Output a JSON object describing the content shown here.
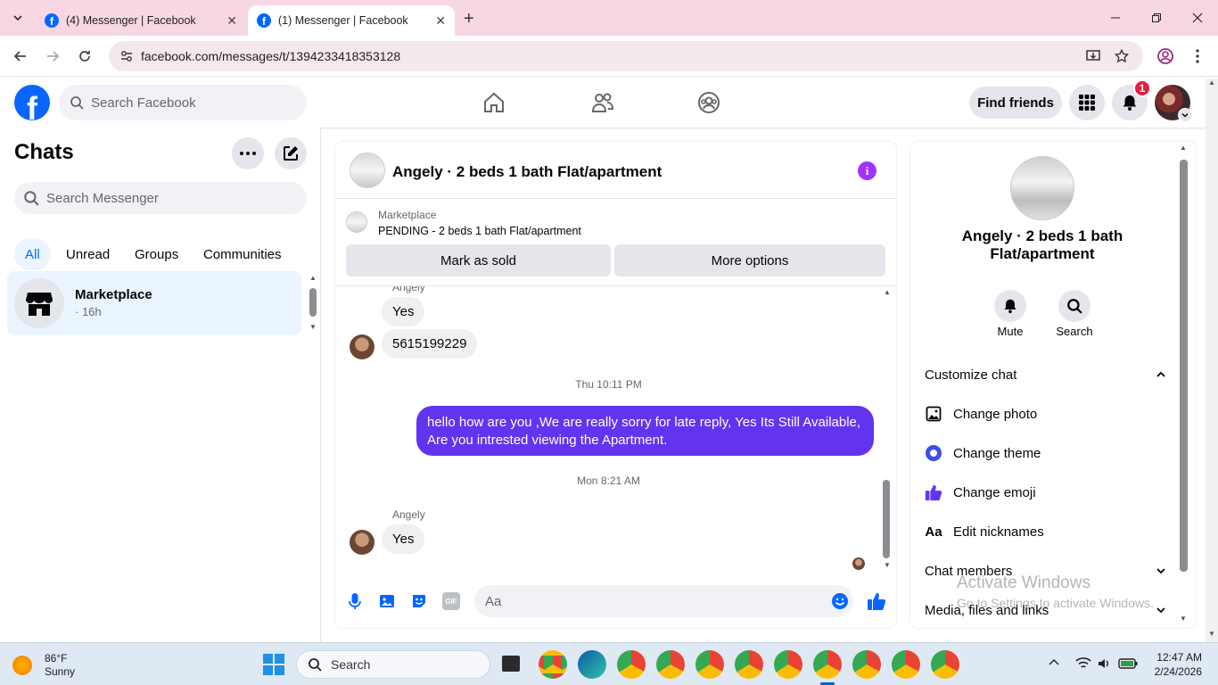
{
  "browser": {
    "tabs": [
      {
        "title": "(4) Messenger | Facebook"
      },
      {
        "title": "(1) Messenger | Facebook"
      }
    ],
    "url": "facebook.com/messages/t/1394233418353128"
  },
  "fb": {
    "search_placeholder": "Search Facebook",
    "find_friends": "Find friends",
    "notification_count": "1"
  },
  "chats": {
    "title": "Chats",
    "search_placeholder": "Search Messenger",
    "filters": [
      "All",
      "Unread",
      "Groups",
      "Communities"
    ],
    "items": [
      {
        "name": "Marketplace",
        "time": "· 16h"
      }
    ]
  },
  "conversation": {
    "title": "Angely · 2 beds 1 bath Flat/apartment",
    "listing_label": "Marketplace",
    "listing_status": "PENDING - 2 beds 1 bath Flat/apartment",
    "mark_sold": "Mark as sold",
    "more_options": "More options",
    "messages": {
      "top_sender": "Angely",
      "msg1": "Yes",
      "msg2": "5615199229",
      "time1": "Thu 10:11 PM",
      "outgoing": "hello how are you ,We are really sorry for late reply, Yes Its Still Available, Are you intrested viewing the Apartment.",
      "time2": "Mon 8:21 AM",
      "sender2": "Angely",
      "msg3": "Yes"
    },
    "composer_placeholder": "Aa"
  },
  "info": {
    "name": "Angely · 2 beds 1 bath Flat/apartment",
    "mute": "Mute",
    "search": "Search",
    "customize": "Customize chat",
    "change_photo": "Change photo",
    "change_theme": "Change theme",
    "change_emoji": "Change emoji",
    "edit_nicknames": "Edit nicknames",
    "chat_members": "Chat members",
    "media": "Media, files and links"
  },
  "watermark": {
    "line1": "Activate Windows",
    "line2": "Go to Settings to activate Windows."
  },
  "taskbar": {
    "weather_temp": "86°F",
    "weather_desc": "Sunny",
    "search": "Search",
    "time": "12:47 AM",
    "date": "2/24/2026"
  },
  "colors": {
    "fb_blue": "#0866ff",
    "messenger_purple": "#7b3ff2",
    "outgoing_bubble": "#6334f0"
  }
}
